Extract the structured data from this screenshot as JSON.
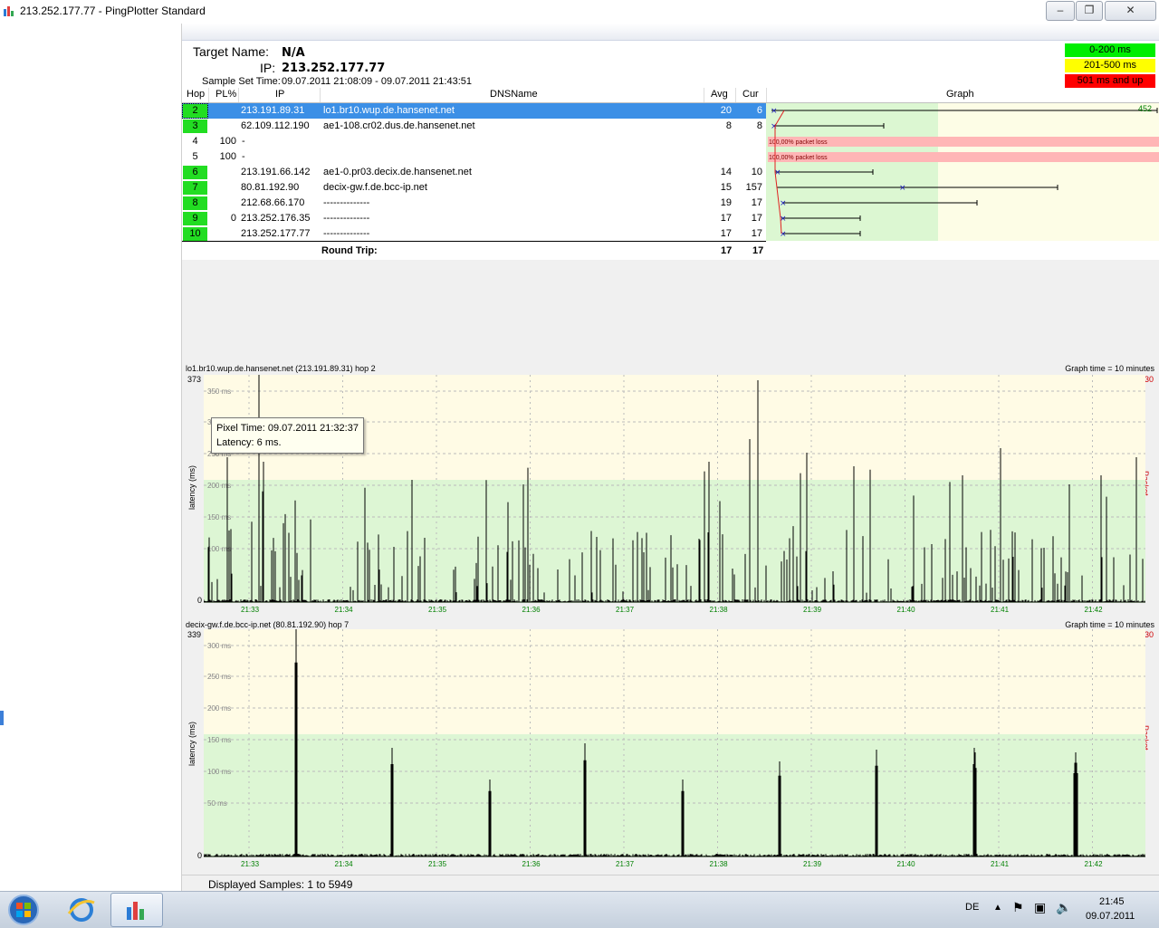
{
  "window": {
    "title": "213.252.177.77 - PingPlotter Standard",
    "buttons": [
      "–",
      "❐",
      "✕"
    ]
  },
  "target": {
    "name_label": "Target Name:",
    "name_value": "N/A",
    "ip_label": "IP:",
    "ip_value": "213.252.177.77",
    "sample_label": "Sample Set Time:",
    "sample_value": "09.07.2011 21:08:09 - 09.07.2011 21:43:51"
  },
  "legend": [
    {
      "label": "0-200 ms",
      "color": "#00ee00"
    },
    {
      "label": "201-500 ms",
      "color": "#ffff00"
    },
    {
      "label": "501 ms and up",
      "color": "#ff0000"
    }
  ],
  "table": {
    "headers": {
      "hop": "Hop",
      "pl": "PL%",
      "ip": "IP",
      "dns": "DNSName",
      "avg": "Avg",
      "cur": "Cur",
      "graph": "Graph"
    },
    "rows": [
      {
        "hop": "2",
        "pl": "",
        "ip": "213.191.89.31",
        "dns": "lo1.br10.wup.de.hansenet.net",
        "avg": "20",
        "cur": "6"
      },
      {
        "hop": "3",
        "pl": "",
        "ip": "62.109.112.190",
        "dns": "ae1-108.cr02.dus.de.hansenet.net",
        "avg": "8",
        "cur": "8"
      },
      {
        "hop": "4",
        "pl": "100",
        "ip": "-",
        "dns": "",
        "avg": "",
        "cur": ""
      },
      {
        "hop": "5",
        "pl": "100",
        "ip": "-",
        "dns": "",
        "avg": "",
        "cur": ""
      },
      {
        "hop": "6",
        "pl": "",
        "ip": "213.191.66.142",
        "dns": "ae1-0.pr03.decix.de.hansenet.net",
        "avg": "14",
        "cur": "10"
      },
      {
        "hop": "7",
        "pl": "",
        "ip": "80.81.192.90",
        "dns": "decix-gw.f.de.bcc-ip.net",
        "avg": "15",
        "cur": "157"
      },
      {
        "hop": "8",
        "pl": "",
        "ip": "212.68.66.170",
        "dns": "--------------",
        "avg": "19",
        "cur": "17"
      },
      {
        "hop": "9",
        "pl": "0",
        "ip": "213.252.176.35",
        "dns": "--------------",
        "avg": "17",
        "cur": "17"
      },
      {
        "hop": "10",
        "pl": "",
        "ip": "213.252.177.77",
        "dns": "--------------",
        "avg": "17",
        "cur": "17"
      }
    ],
    "round_trip": {
      "label": "Round Trip:",
      "avg": "17",
      "cur": "17"
    },
    "graph_max_label": "452",
    "packet_loss_text": "100,00% packet loss"
  },
  "chart1": {
    "title": "lo1.br10.wup.de.hansenet.net (213.191.89.31) hop 2",
    "graph_time": "Graph time = 10 minutes",
    "ymax": "373",
    "ymin": "0",
    "pl_max": "30",
    "ylabel": "latency (ms)",
    "pl_label": "Packet Loss %",
    "gridlabels": [
      "350 ms",
      "300 ms",
      "250 ms",
      "200 ms",
      "150 ms",
      "100 ms"
    ],
    "xticks": [
      "21:33",
      "21:34",
      "21:35",
      "21:36",
      "21:37",
      "21:38",
      "21:39",
      "21:40",
      "21:41",
      "21:42"
    ]
  },
  "chart2": {
    "title": "decix-gw.f.de.bcc-ip.net (80.81.192.90) hop 7",
    "graph_time": "Graph time = 10 minutes",
    "ymax": "339",
    "ymin": "0",
    "pl_max": "30",
    "ylabel": "latency (ms)",
    "pl_label": "Packet Loss %",
    "gridlabels": [
      "300 ms",
      "250 ms",
      "200 ms",
      "150 ms",
      "100 ms",
      "50 ms"
    ],
    "xticks": [
      "21:33",
      "21:34",
      "21:35",
      "21:36",
      "21:37",
      "21:38",
      "21:39",
      "21:40",
      "21:41",
      "21:42"
    ]
  },
  "tooltip": {
    "line1": "Pixel Time: 09.07.2011 21:32:37",
    "line2": "Latency: 6 ms."
  },
  "status": {
    "text": "Displayed Samples: 1 to 5949"
  },
  "taskbar": {
    "lang": "DE",
    "time": "21:45",
    "date": "09.07.2011"
  }
}
